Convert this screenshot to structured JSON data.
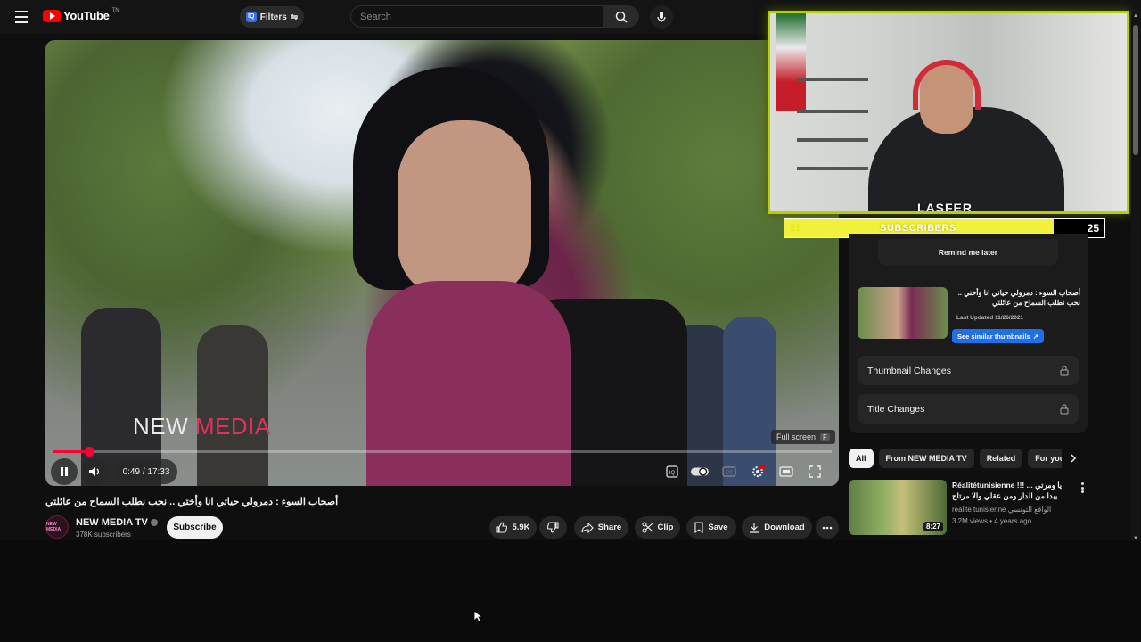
{
  "header": {
    "logo_text": "YouTube",
    "logo_sup": "TN",
    "filters_label": "Filters",
    "search_placeholder": "Search"
  },
  "player": {
    "watermark_left": "NEW ",
    "watermark_right": "MEDIA",
    "fullscreen_tip": "Full screen",
    "fullscreen_key": "F",
    "time": "0:49 / 17:33",
    "progress": 0.047
  },
  "video": {
    "title": "أصحاب السوء : دمرولي حياتي انا وأختي .. نحب نطلب السماح من عائلتي",
    "channel_avatar": "NEW MEDIA",
    "channel_name": "NEW MEDIA TV",
    "subscribers": "378K subscribers",
    "subscribe_label": "Subscribe",
    "likes": "5.9K",
    "share_label": "Share",
    "clip_label": "Clip",
    "save_label": "Save",
    "download_label": "Download"
  },
  "webcam": {
    "logo": "LASFER",
    "sub_current": "21",
    "sub_label": "SUBSCRIBERS",
    "sub_goal": "25",
    "sub_fraction": 0.84
  },
  "extension": {
    "remind_label": "Remind me later",
    "thumb_title": "أصحاب السوء : دمرولي حياتي انا وأختي .. نحب نطلب السماح من عائلتي",
    "last_updated": "Last Updated 11/26/2021",
    "similar_label": "See similar thumbnails",
    "thumbnail_changes": "Thumbnail Changes",
    "title_changes": "Title Changes"
  },
  "chips": [
    "All",
    "From NEW MEDIA TV",
    "Related",
    "For you"
  ],
  "recommendation": {
    "title": "Réalitétunisienne !!! يا ومرتي ... يبدا من الدار ومن عقلي والا مرتاح واحد في ...",
    "channel": "realite tunisienne الواقع التونسي",
    "meta": "3.2M views • 4 years ago",
    "duration": "8:27"
  },
  "colors": {
    "accent_red": "#ff0033",
    "subscriber_bar": "#f1f03a",
    "webcam_border": "#b7d000",
    "link_blue": "#1f6feb"
  }
}
